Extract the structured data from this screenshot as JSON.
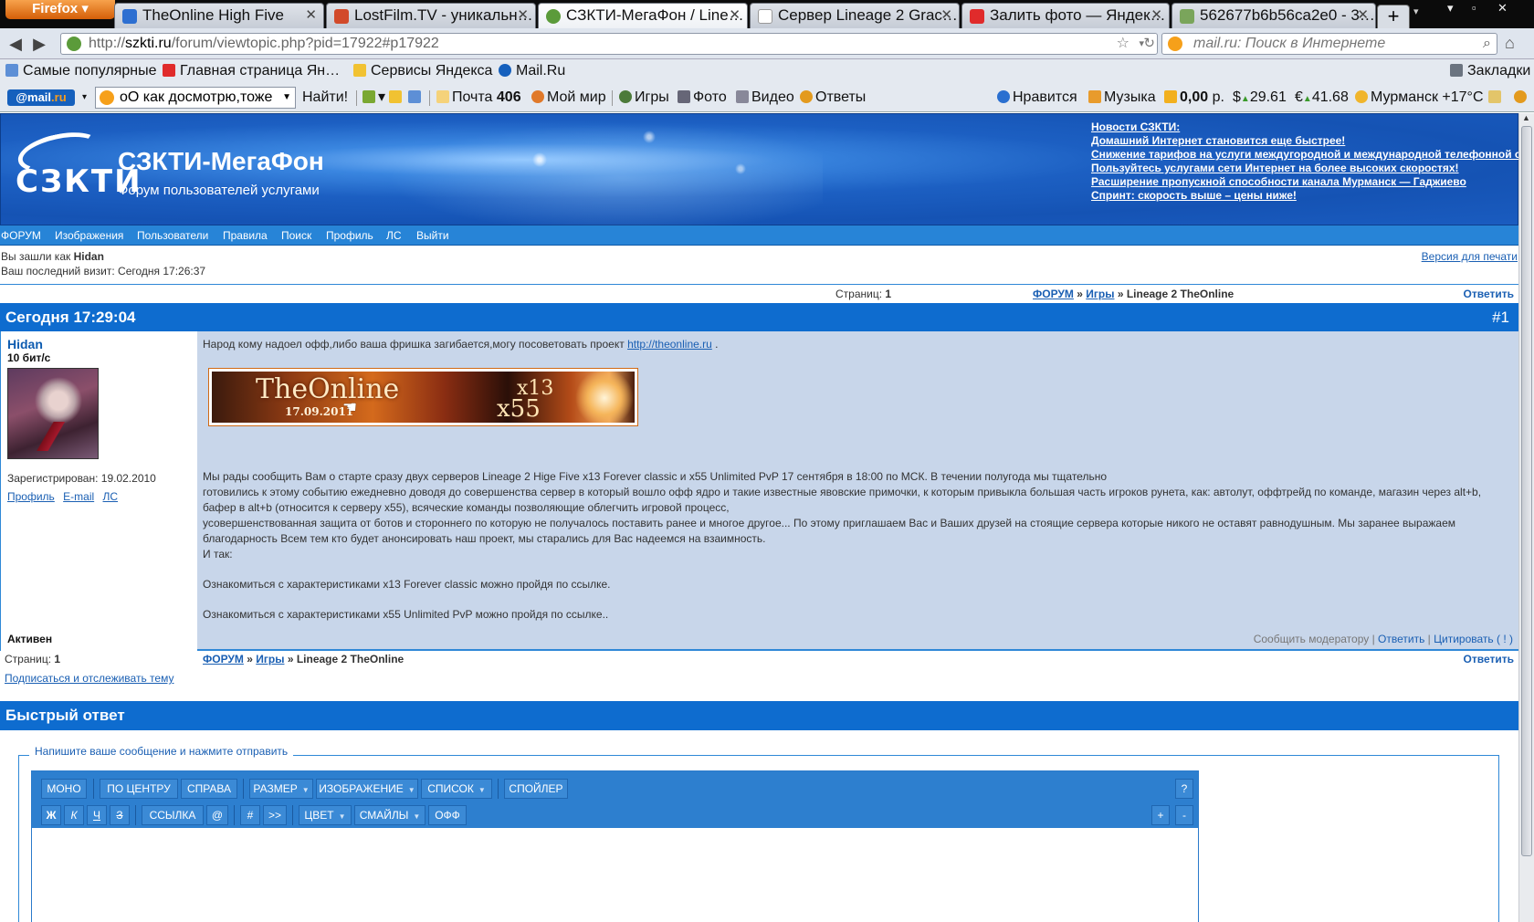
{
  "browser": {
    "firefox_label": "Firefox",
    "tabs": [
      {
        "title": "TheOnline High Five",
        "fav": "#2d6fd1"
      },
      {
        "title": "LostFilm.TV - уникальн…",
        "fav": "#d24a2a"
      },
      {
        "title": "СЗКТИ-МегаФон / Line…",
        "fav": "#5b9b3a"
      },
      {
        "title": "Сервер Lineage 2 Grac…",
        "fav": "#ffffff"
      },
      {
        "title": "Залить фото — Яндек…",
        "fav": "#e02b2b"
      },
      {
        "title": "562677b6b56ca2e0 - 3…",
        "fav": "#7aa55b"
      }
    ],
    "new_tab": "+",
    "url_prefix": "http://",
    "url_host": "szkti.ru",
    "url_path": "/forum/viewtopic.php?pid=17922#p17922",
    "search_placeholder": "mail.ru: Поиск в Интернете"
  },
  "bookmarks": [
    {
      "label": "Самые популярные",
      "color": "#5d8fd6"
    },
    {
      "label": "Главная страница Ян…",
      "color": "#e02b2b"
    },
    {
      "label": "Сервисы Яндекса",
      "color": "#f1c232"
    },
    {
      "label": "Mail.Ru",
      "color": "#1560bd"
    }
  ],
  "bookmarks_right": "Закладки",
  "mailbar": {
    "logo": "@mail",
    "logo_suffix": ".ru",
    "search_text": "оО как досмотрю,тоже",
    "find": "Найти!",
    "mail_label": "Почта",
    "mail_count": "406",
    "myworld": "Мой мир",
    "games": "Игры",
    "photo": "Фото",
    "video": "Видео",
    "answers": "Ответы",
    "likes": "Нравится",
    "music": "Музыка",
    "balance": "0,00",
    "balance_unit": "р.",
    "usd": "29.61",
    "eur": "41.68",
    "weather": "Мурманск +17°C"
  },
  "site": {
    "logo_text": "СЗКТИ",
    "title": "СЗКТИ-МегаФон",
    "subtitle": "Форум пользователей услугами",
    "news_title": "Новости СЗКТИ:",
    "news": [
      "Домашний Интернет становится еще быстрее!",
      "Снижение тарифов на услуги междугородной и международной телефонной связи",
      "Пользуйтесь услугами сети Интернет на более высоких скоростях!",
      "Расширение пропускной способности канала Мурманск — Гаджиево",
      "Спринт: скорость выше – цены ниже!"
    ],
    "menu": [
      "ФОРУМ",
      "Изображения",
      "Пользователи",
      "Правила",
      "Поиск",
      "Профиль",
      "ЛС",
      "Выйти"
    ]
  },
  "userinfo": {
    "logged_as": "Вы зашли как",
    "username": "Hidan",
    "last_visit": "Ваш последний визит: Сегодня 17:26:37",
    "print_version": "Версия для печати"
  },
  "topic": {
    "pages_label": "Страниц:",
    "pages_value": "1",
    "crumb_forum": "ФОРУМ",
    "crumb_sep": "»",
    "crumb_games": "Игры",
    "crumb_topic": "Lineage 2 TheOnline",
    "reply": "Ответить",
    "subscribe": "Подписаться и отслеживать тему"
  },
  "post": {
    "date": "Сегодня 17:29:04",
    "number": "#1",
    "author": "Hidan",
    "speed": "10 бит/с",
    "registered": "Зарегистрирован: 19.02.2010",
    "links": [
      "Профиль",
      "E-mail",
      "ЛС"
    ],
    "status": "Активен",
    "intro": "Народ кому надоел офф,либо ваша фришка загибается,могу посоветовать проект",
    "intro_link": "http://theonline.ru",
    "intro_end": ".",
    "banner_title": "TheOnline",
    "banner_date": "17.09.2011",
    "banner_x13": "x13",
    "banner_x55": "x55",
    "body_lines": [
      "Мы рады сообщить Вам о старте сразу двух серверов Lineage 2 Hige Five x13 Forever classic и x55 Unlimited PvP 17 сентября в 18:00 по МСК. В течении полугода мы тщательно",
      "готовились к этому событию ежедневно доводя до совершенства сервер в который вошло офф ядро и такие известные явовские примочки, к которым привыкла большая часть игроков рунета, как: автолут, оффтрейд по команде, магазин через alt+b,",
      "бафер в alt+b (относится к серверу x55), всяческие команды позволяющие облегчить игровой процесс,",
      "усовершенствованная защита от ботов и стороннего по которую не получалось поставить ранее и многое другое... По этому приглашаем Вас и Ваших друзей на стоящие сервера которые никого не оставят равнодушным. Мы заранее выражаем",
      "благодарность Всем тем кто будет анонсировать наш проект, мы старались для Вас надеемся на взаимность.",
      "И так:",
      "",
      "Ознакомиться с характеристиками x13 Forever classic можно пройдя по ссылке.",
      "",
      "Ознакомиться с характеристиками x55 Unlimited PvP можно пройдя по ссылке.."
    ],
    "report": "Сообщить модератору",
    "reply": "Ответить",
    "quote": "Цитировать ( ! )"
  },
  "quick_reply": {
    "title": "Быстрый ответ",
    "legend": "Напишите ваше сообщение и нажмите отправить",
    "toolbar_row1": [
      "МОНО",
      "ПО ЦЕНТРУ",
      "СПРАВА",
      "РАЗМЕР",
      "ИЗОБРАЖЕНИЕ",
      "СПИСОК",
      "СПОЙЛЕР"
    ],
    "help": "?",
    "toolbar_row2": [
      "Ж",
      "К",
      "Ч",
      "З",
      "ССЫЛКА",
      "@",
      "#",
      ">>",
      "ЦВЕТ",
      "СМАЙЛЫ",
      "ОФФ"
    ],
    "plus": "+",
    "minus": "-",
    "dropdown_arrow": "▼"
  }
}
